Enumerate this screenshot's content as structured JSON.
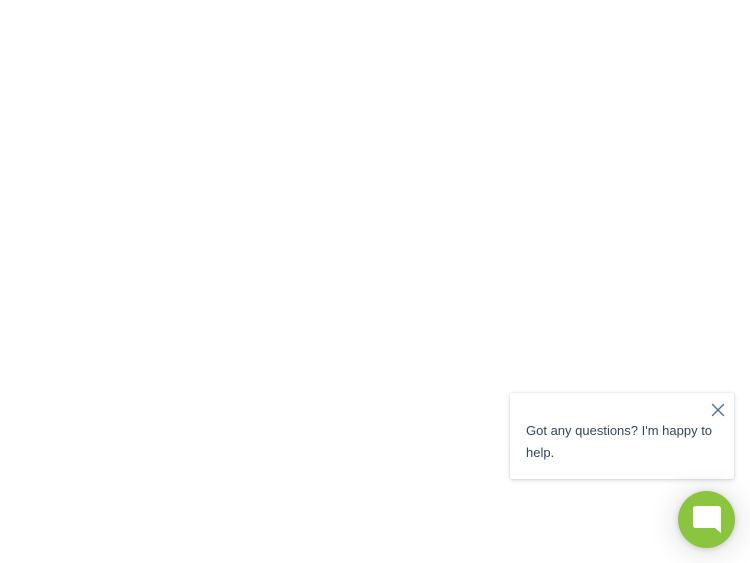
{
  "chat_widget": {
    "welcome_message": "Got any questions? I'm happy to help.",
    "close_icon": "close-icon",
    "launcher_icon": "chat-bubble-icon",
    "accent_color": "#8bc540",
    "text_color": "#33475b"
  }
}
